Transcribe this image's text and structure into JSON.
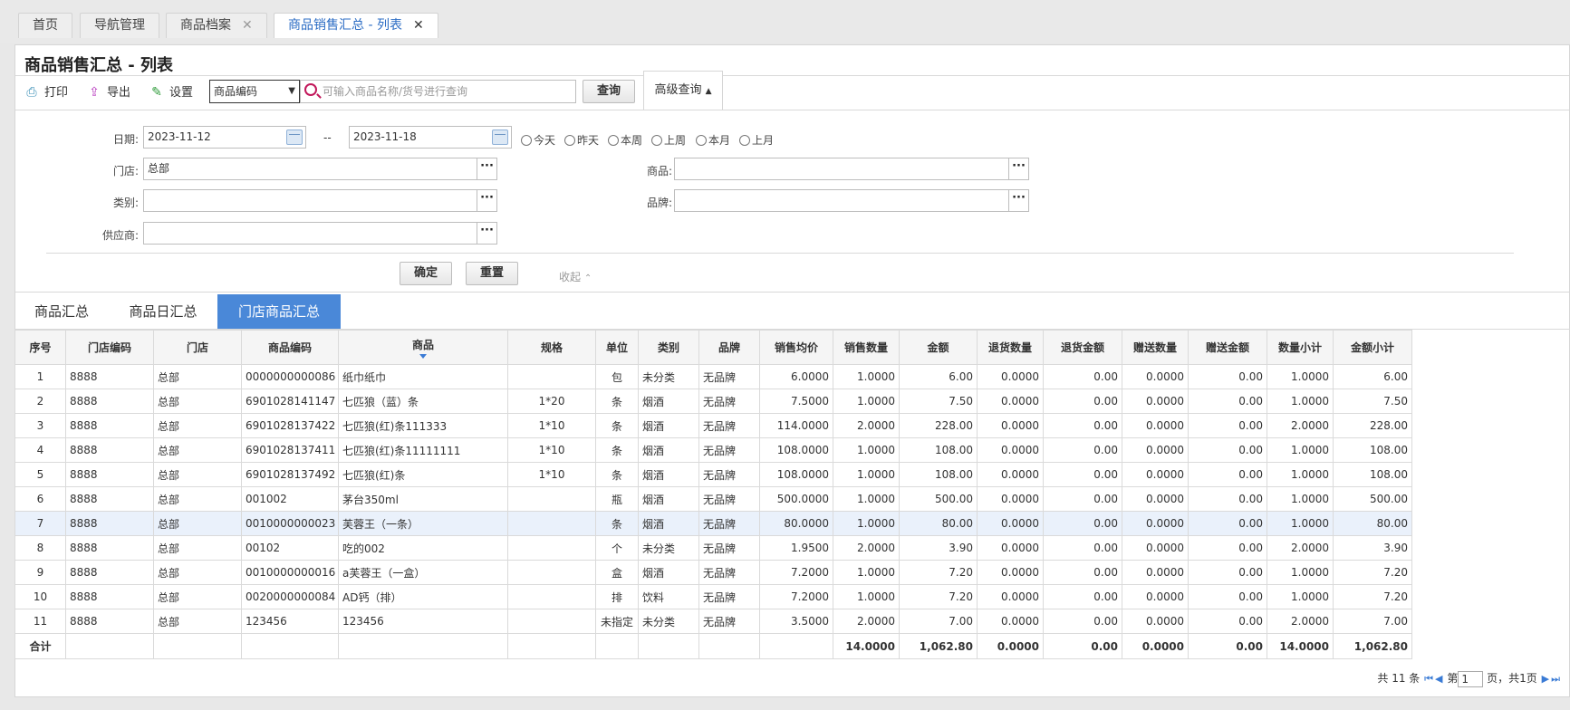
{
  "tabs": [
    {
      "label": "首页"
    },
    {
      "label": "导航管理"
    },
    {
      "label": "商品档案",
      "close": "✕"
    },
    {
      "label": "商品销售汇总 - 列表",
      "close": "✕"
    }
  ],
  "page_title": "商品销售汇总 - 列表",
  "toolbar": {
    "print": "打印",
    "export": "导出",
    "settings": "设置",
    "select_value": "商品编码",
    "search_placeholder": "可输入商品名称/货号进行查询",
    "query": "查询",
    "advanced": "高级查询"
  },
  "filter": {
    "date_label": "日期:",
    "date_from": "2023-11-12",
    "date_sep": "--",
    "date_to": "2023-11-18",
    "radios": [
      "今天",
      "昨天",
      "本周",
      "上周",
      "本月",
      "上月"
    ],
    "store_label": "门店:",
    "store_value": "总部",
    "product_label": "商品:",
    "category_label": "类别:",
    "brand_label": "品牌:",
    "supplier_label": "供应商:",
    "confirm": "确定",
    "reset": "重置",
    "collapse": "收起"
  },
  "subtabs": [
    "商品汇总",
    "商品日汇总",
    "门店商品汇总"
  ],
  "columns": [
    "序号",
    "门店编码",
    "门店",
    "商品编码",
    "商品",
    "规格",
    "单位",
    "类别",
    "品牌",
    "销售均价",
    "销售数量",
    "金额",
    "退货数量",
    "退货金额",
    "赠送数量",
    "赠送金额",
    "数量小计",
    "金额小计"
  ],
  "rows": [
    [
      "1",
      "8888",
      "总部",
      "0000000000086",
      "纸巾纸巾",
      "",
      "包",
      "未分类",
      "无品牌",
      "6.0000",
      "1.0000",
      "6.00",
      "0.0000",
      "0.00",
      "0.0000",
      "0.00",
      "1.0000",
      "6.00"
    ],
    [
      "2",
      "8888",
      "总部",
      "6901028141147",
      "七匹狼（蓝）条",
      "1*20",
      "条",
      "烟酒",
      "无品牌",
      "7.5000",
      "1.0000",
      "7.50",
      "0.0000",
      "0.00",
      "0.0000",
      "0.00",
      "1.0000",
      "7.50"
    ],
    [
      "3",
      "8888",
      "总部",
      "6901028137422",
      "七匹狼(红)条111333",
      "1*10",
      "条",
      "烟酒",
      "无品牌",
      "114.0000",
      "2.0000",
      "228.00",
      "0.0000",
      "0.00",
      "0.0000",
      "0.00",
      "2.0000",
      "228.00"
    ],
    [
      "4",
      "8888",
      "总部",
      "6901028137411",
      "七匹狼(红)条11111111",
      "1*10",
      "条",
      "烟酒",
      "无品牌",
      "108.0000",
      "1.0000",
      "108.00",
      "0.0000",
      "0.00",
      "0.0000",
      "0.00",
      "1.0000",
      "108.00"
    ],
    [
      "5",
      "8888",
      "总部",
      "6901028137492",
      "七匹狼(红)条",
      "1*10",
      "条",
      "烟酒",
      "无品牌",
      "108.0000",
      "1.0000",
      "108.00",
      "0.0000",
      "0.00",
      "0.0000",
      "0.00",
      "1.0000",
      "108.00"
    ],
    [
      "6",
      "8888",
      "总部",
      "001002",
      "茅台350ml",
      "",
      "瓶",
      "烟酒",
      "无品牌",
      "500.0000",
      "1.0000",
      "500.00",
      "0.0000",
      "0.00",
      "0.0000",
      "0.00",
      "1.0000",
      "500.00"
    ],
    [
      "7",
      "8888",
      "总部",
      "0010000000023",
      "芙蓉王（一条）",
      "",
      "条",
      "烟酒",
      "无品牌",
      "80.0000",
      "1.0000",
      "80.00",
      "0.0000",
      "0.00",
      "0.0000",
      "0.00",
      "1.0000",
      "80.00"
    ],
    [
      "8",
      "8888",
      "总部",
      "00102",
      "吃的002",
      "",
      "个",
      "未分类",
      "无品牌",
      "1.9500",
      "2.0000",
      "3.90",
      "0.0000",
      "0.00",
      "0.0000",
      "0.00",
      "2.0000",
      "3.90"
    ],
    [
      "9",
      "8888",
      "总部",
      "0010000000016",
      "a芙蓉王（一盒）",
      "",
      "盒",
      "烟酒",
      "无品牌",
      "7.2000",
      "1.0000",
      "7.20",
      "0.0000",
      "0.00",
      "0.0000",
      "0.00",
      "1.0000",
      "7.20"
    ],
    [
      "10",
      "8888",
      "总部",
      "0020000000084",
      "AD钙（排）",
      "",
      "排",
      "饮料",
      "无品牌",
      "7.2000",
      "1.0000",
      "7.20",
      "0.0000",
      "0.00",
      "0.0000",
      "0.00",
      "1.0000",
      "7.20"
    ],
    [
      "11",
      "8888",
      "总部",
      "123456",
      "123456",
      "",
      "未指定",
      "未分类",
      "无品牌",
      "3.5000",
      "2.0000",
      "7.00",
      "0.0000",
      "0.00",
      "0.0000",
      "0.00",
      "2.0000",
      "7.00"
    ]
  ],
  "totals": [
    "合计",
    "",
    "",
    "",
    "",
    "",
    "",
    "",
    "",
    "",
    "14.0000",
    "1,062.80",
    "0.0000",
    "0.00",
    "0.0000",
    "0.00",
    "14.0000",
    "1,062.80"
  ],
  "pager": {
    "total": "共 11 条",
    "page_prefix": "第",
    "page": "1",
    "page_suffix": "页，共1页"
  }
}
